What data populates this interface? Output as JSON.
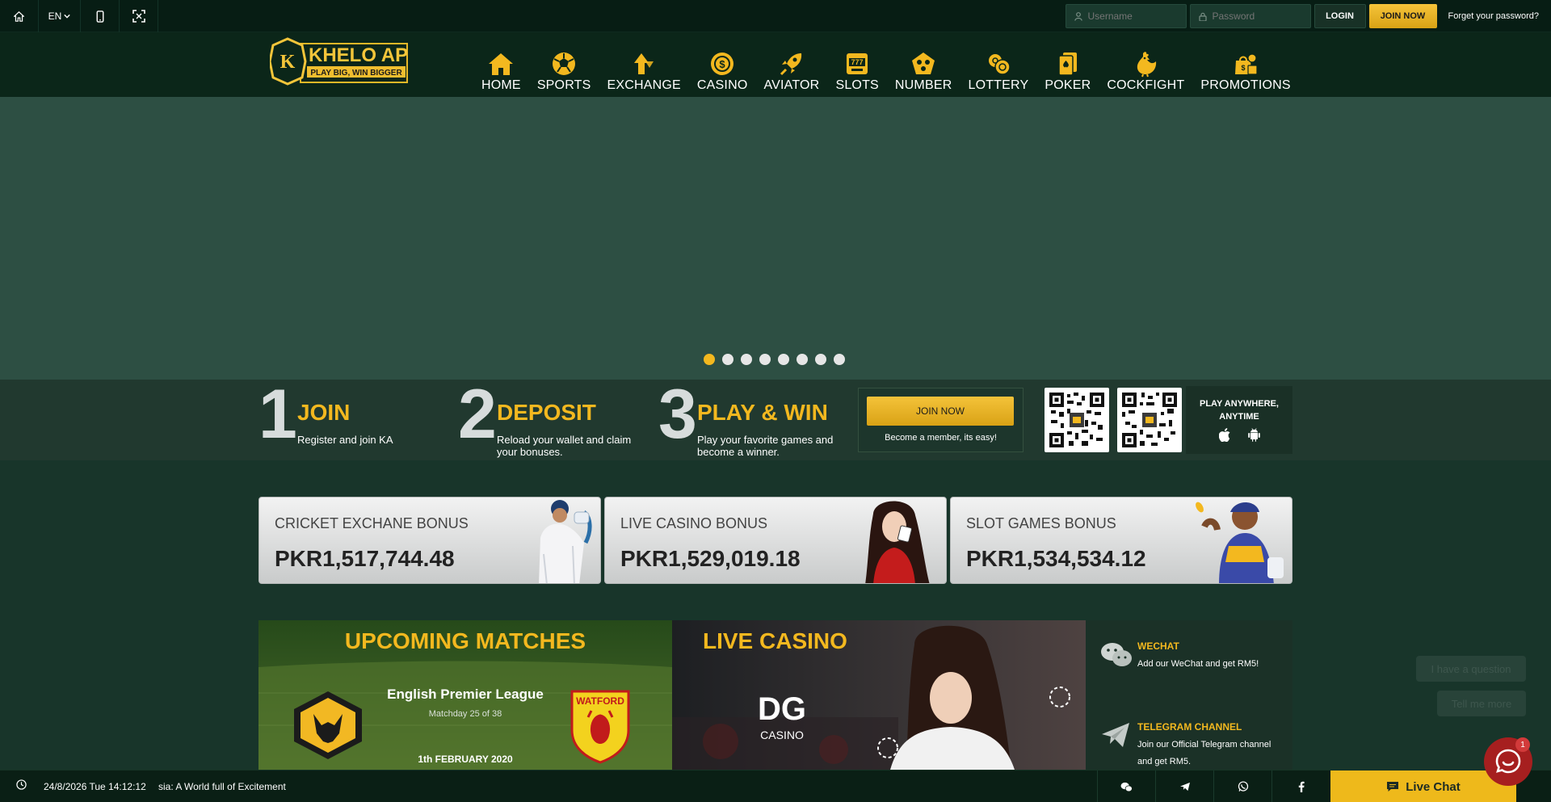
{
  "topbar": {
    "home_icon": "home-icon",
    "language": "EN",
    "username_placeholder": "Username",
    "password_placeholder": "Password",
    "login_label": "LOGIN",
    "join_label": "JOIN NOW",
    "forgot_label": "Forget your password?"
  },
  "logo": {
    "name": "KHELO AP",
    "tagline": "PLAY BIG, WIN BIGGER"
  },
  "nav": [
    {
      "label": "HOME",
      "icon": "home-icon"
    },
    {
      "label": "SPORTS",
      "icon": "soccer-ball-icon"
    },
    {
      "label": "EXCHANGE",
      "icon": "exchange-arrows-icon"
    },
    {
      "label": "CASINO",
      "icon": "casino-chip-icon"
    },
    {
      "label": "AVIATOR",
      "icon": "rocket-icon"
    },
    {
      "label": "SLOTS",
      "icon": "slot-machine-icon"
    },
    {
      "label": "NUMBER",
      "icon": "number-balls-icon"
    },
    {
      "label": "LOTTERY",
      "icon": "lottery-balls-icon"
    },
    {
      "label": "POKER",
      "icon": "poker-cards-icon"
    },
    {
      "label": "COCKFIGHT",
      "icon": "rooster-icon"
    },
    {
      "label": "PROMOTIONS",
      "icon": "gift-bag-icon"
    }
  ],
  "banner": {
    "slide_count": 8,
    "active_slide": 1
  },
  "steps": [
    {
      "num": "1",
      "title": "JOIN",
      "desc": "Register and join KA"
    },
    {
      "num": "2",
      "title": "DEPOSIT",
      "desc": "Reload your wallet and claim your bonuses."
    },
    {
      "num": "3",
      "title": "PLAY & WIN",
      "desc": "Play your favorite games and become a winner."
    }
  ],
  "joinbox": {
    "button": "JOIN NOW",
    "text": "Become a member, its easy!"
  },
  "play_anywhere": "PLAY ANYWHERE, ANYTIME",
  "bonuses": [
    {
      "title": "CRICKET EXCHANE BONUS",
      "value": "PKR1,517,744.48"
    },
    {
      "title": "LIVE CASINO BONUS",
      "value": "PKR1,529,019.18"
    },
    {
      "title": "SLOT GAMES BONUS",
      "value": "PKR1,534,534.12"
    }
  ],
  "matches": {
    "title": "UPCOMING MATCHES",
    "league": "English Premier League",
    "matchday": "Matchday 25 of 38",
    "date": "1th FEBRUARY 2020",
    "away_badge": "WATFORD"
  },
  "live_casino": {
    "title": "LIVE CASINO",
    "provider": "DG",
    "provider_sub": "CASINO"
  },
  "social": [
    {
      "title": "WECHAT",
      "desc": "Add our WeChat and get RM5!",
      "icon": "wechat-icon"
    },
    {
      "title": "TELEGRAM CHANNEL",
      "desc": "Join our Official Telegram channel and get RM5.",
      "icon": "telegram-icon"
    }
  ],
  "chat_chips": [
    "I have a question",
    "Tell me more"
  ],
  "bottombar": {
    "datetime": "24/8/2026 Tue 14:12:12",
    "marquee": "sia: A World full of Excitement",
    "live_chat": "Live Chat",
    "chat_badge": "1"
  },
  "colors": {
    "accent": "#f3b81f",
    "background": "#18352a",
    "header": "#0b2619"
  }
}
